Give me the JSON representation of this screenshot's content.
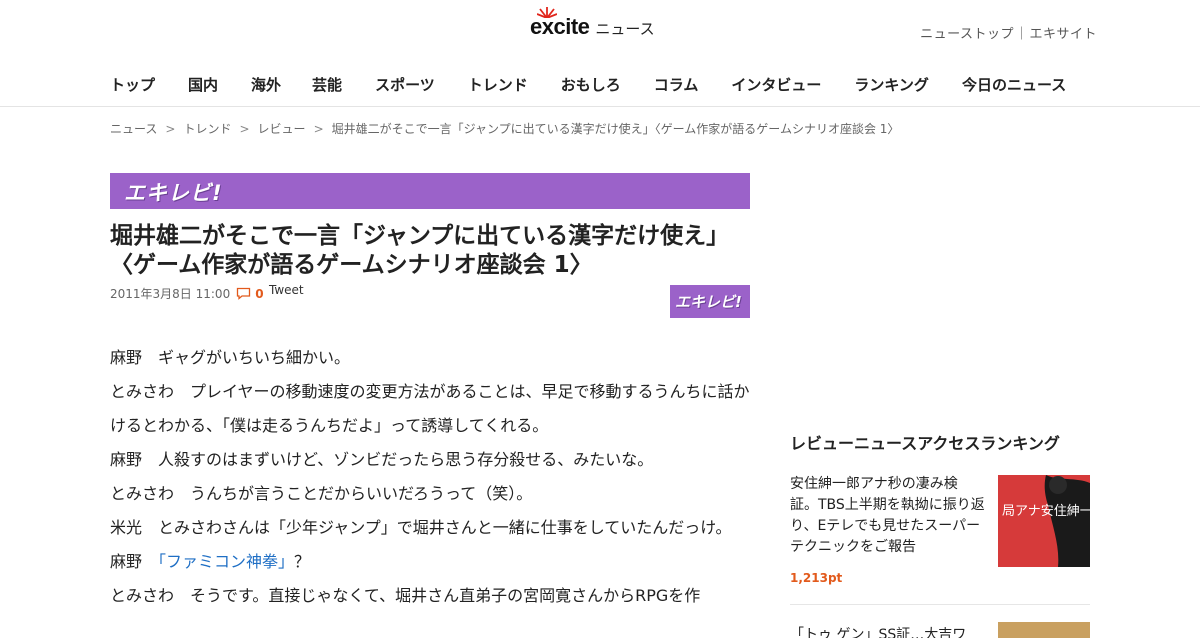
{
  "header": {
    "logo_text": "excite",
    "logo_section": "ニュース",
    "toplinks": [
      "ニューストップ",
      "エキサイト"
    ],
    "toplinks_sep": "｜"
  },
  "nav": {
    "items": [
      "トップ",
      "国内",
      "海外",
      "芸能",
      "スポーツ",
      "トレンド",
      "おもしろ",
      "コラム",
      "インタビュー",
      "ランキング",
      "今日のニュース"
    ]
  },
  "breadcrumb": {
    "items": [
      "ニュース",
      "トレンド",
      "レビュー",
      "堀井雄二がそこで一言「ジャンプに出ている漢字だけ使え」〈ゲーム作家が語るゲームシナリオ座談会 1〉"
    ],
    "separator": ">"
  },
  "article": {
    "banner_text": "エキレビ!",
    "badge_text": "エキレビ!",
    "title": "堀井雄二がそこで一言「ジャンプに出ている漢字だけ使え」〈ゲーム作家が語るゲームシナリオ座談会 1〉",
    "date": "2011年3月8日 11:00",
    "comment_count": "0",
    "tweet_label": "Tweet",
    "paragraphs": [
      "麻野　ギャグがいちいち細かい。",
      "とみさわ　プレイヤーの移動速度の変更方法があることは、早足で移動するうんちに話かけるとわかる、「僕は走るうんちだよ」って誘導してくれる。",
      "麻野　人殺すのはまずいけど、ゾンビだったら思う存分殺せる、みたいな。",
      "とみさわ　うんちが言うことだからいいだろうって（笑）。",
      "米光　とみさわさんは「少年ジャンプ」で堀井さんと一緒に仕事をしていたんだっけ。"
    ],
    "p6_prefix": "麻野　",
    "p6_link": "「ファミコン神拳」",
    "p6_suffix": "？",
    "p7": "とみさわ　そうです。直接じゃなくて、堀井さん直弟子の宮岡寛さんからRPGを作"
  },
  "sidebar": {
    "ranking_title": "レビューニュースアクセスランキング",
    "items": [
      {
        "text": "安住紳一郎アナ秒の凄み検証。TBS上半期を執拗に振り返り、Eテレでも見せたスーパーテクニックをご報告",
        "points": "1,213pt",
        "thumb_text": "局アナ安住紳一郎"
      },
      {
        "text": "「トゥ ゲン」SS証…大吉ワ"
      }
    ]
  },
  "colors": {
    "accent_purple": "#9b62c9",
    "points_orange": "#e25a1c",
    "link_blue": "#1f6fc5"
  }
}
